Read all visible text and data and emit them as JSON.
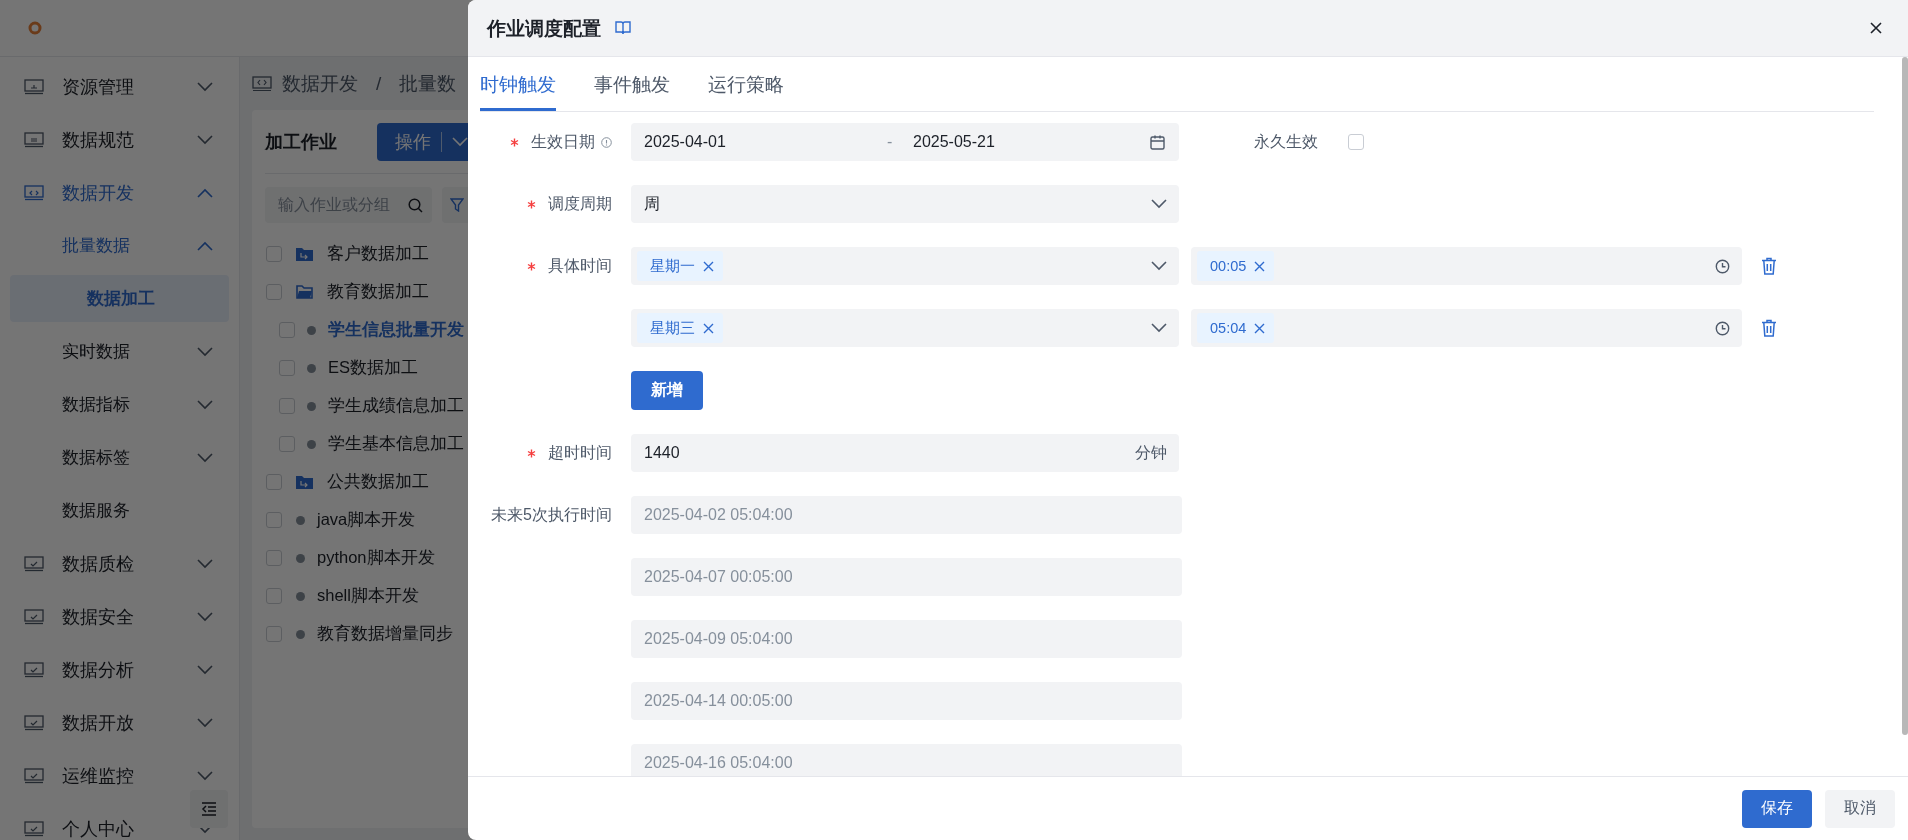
{
  "app": {
    "breadcrumb": {
      "items": [
        "数据开发",
        "批量数"
      ],
      "separator": "/"
    },
    "sidebar": [
      {
        "label": "资源管理",
        "expanded": false,
        "selected": false
      },
      {
        "label": "数据规范",
        "expanded": false,
        "selected": false
      },
      {
        "label": "数据开发",
        "expanded": true,
        "selected": false,
        "children": [
          {
            "label": "批量数据",
            "expanded": true,
            "selected": false,
            "children": [
              {
                "label": "数据加工",
                "selected": true
              }
            ]
          },
          {
            "label": "实时数据",
            "expanded": false,
            "selected": false
          },
          {
            "label": "数据指标",
            "expanded": false,
            "selected": false
          },
          {
            "label": "数据标签",
            "expanded": false,
            "selected": false
          },
          {
            "label": "数据服务",
            "selected": false
          }
        ]
      },
      {
        "label": "数据质检",
        "expanded": false,
        "selected": false
      },
      {
        "label": "数据安全",
        "expanded": false,
        "selected": false
      },
      {
        "label": "数据分析",
        "expanded": false,
        "selected": false
      },
      {
        "label": "数据开放",
        "expanded": false,
        "selected": false
      },
      {
        "label": "运维监控",
        "expanded": false,
        "selected": false
      },
      {
        "label": "个人中心",
        "expanded": false,
        "selected": false
      }
    ],
    "panel": {
      "title": "加工作业",
      "action_button": "操作",
      "search": {
        "placeholder": "输入作业或分组"
      },
      "tree": [
        {
          "label": "客户数据加工",
          "kind": "folder",
          "expanded": false,
          "checked": false,
          "selected": false
        },
        {
          "label": "教育数据加工",
          "kind": "folder",
          "expanded": true,
          "checked": false,
          "selected": false,
          "children": [
            {
              "label": "学生信息批量开发",
              "kind": "job",
              "checked": false,
              "selected": true
            },
            {
              "label": "ES数据加工",
              "kind": "job",
              "checked": false,
              "selected": false
            },
            {
              "label": "学生成绩信息加工",
              "kind": "job",
              "checked": false,
              "selected": false
            },
            {
              "label": "学生基本信息加工",
              "kind": "job",
              "checked": false,
              "selected": false
            }
          ]
        },
        {
          "label": "公共数据加工",
          "kind": "folder",
          "expanded": false,
          "checked": false,
          "selected": false
        },
        {
          "label": "java脚本开发",
          "kind": "job",
          "checked": false,
          "selected": false
        },
        {
          "label": "python脚本开发",
          "kind": "job",
          "checked": false,
          "selected": false
        },
        {
          "label": "shell脚本开发",
          "kind": "job",
          "checked": false,
          "selected": false
        },
        {
          "label": "教育数据增量同步",
          "kind": "job",
          "checked": false,
          "selected": false
        }
      ]
    }
  },
  "drawer": {
    "title": "作业调度配置",
    "tabs": [
      {
        "label": "时钟触发",
        "selected": true
      },
      {
        "label": "事件触发",
        "selected": false
      },
      {
        "label": "运行策略",
        "selected": false
      }
    ],
    "form": {
      "effective_date": {
        "label": "生效日期",
        "required": true,
        "start": "2025-04-01",
        "separator": "-",
        "end": "2025-05-21"
      },
      "permanent": {
        "label": "永久生效",
        "checked": false
      },
      "cycle": {
        "label": "调度周期",
        "required": true,
        "value": "周"
      },
      "specific_time": {
        "label": "具体时间",
        "required": true,
        "rows": [
          {
            "days": [
              "星期一"
            ],
            "times": [
              "00:05"
            ]
          },
          {
            "days": [
              "星期三"
            ],
            "times": [
              "05:04"
            ]
          }
        ]
      },
      "add_button": "新增",
      "timeout": {
        "label": "超时时间",
        "required": true,
        "value": "1440",
        "suffix": "分钟"
      },
      "next_runs": {
        "label": "未来5次执行时间",
        "values": [
          "2025-04-02 05:04:00",
          "2025-04-07 00:05:00",
          "2025-04-09 05:04:00",
          "2025-04-14 00:05:00",
          "2025-04-16 05:04:00"
        ]
      }
    },
    "buttons": [
      {
        "label": "保存",
        "kind": "primary"
      },
      {
        "label": "取消",
        "kind": "secondary"
      }
    ]
  }
}
